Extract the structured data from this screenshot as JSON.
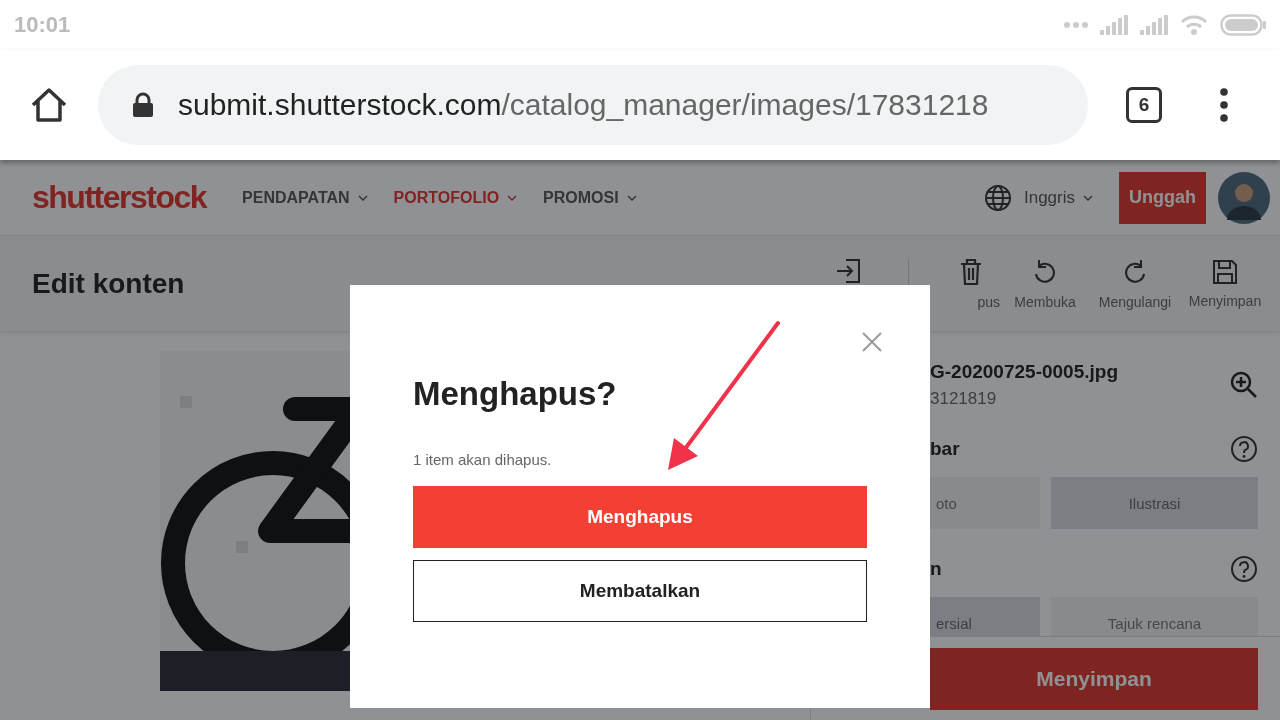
{
  "status_bar": {
    "time": "10:01"
  },
  "browser": {
    "url_host": "submit.shutterstock.com",
    "url_path": "/catalog_manager/images/17831218",
    "tab_count": "6"
  },
  "header": {
    "logo": "shutterstock",
    "nav": [
      {
        "label": "PENDAPATAN",
        "selected": false
      },
      {
        "label": "PORTOFOLIO",
        "selected": true
      },
      {
        "label": "PROMOSI",
        "selected": false
      }
    ],
    "language": "Inggris",
    "upload": "Unggah"
  },
  "page": {
    "title": "Edit konten",
    "toolbar": [
      {
        "kind": "submit"
      },
      {
        "kind": "delete",
        "label": "pus"
      },
      {
        "kind": "undo",
        "label": "Membuka"
      },
      {
        "kind": "redo",
        "label": "Mengulangi"
      },
      {
        "kind": "save",
        "label": "Menyimpan"
      }
    ]
  },
  "panel": {
    "filename": "G-20200725-0005.jpg",
    "id": "3121819",
    "sections": [
      {
        "heading": "bar",
        "options": [
          {
            "label": "oto",
            "selected": false
          },
          {
            "label": "Ilustrasi",
            "selected": true
          }
        ]
      },
      {
        "heading": "n",
        "options": [
          {
            "label": "ersial",
            "selected": true
          },
          {
            "label": "Tajuk rencana",
            "selected": false
          }
        ]
      }
    ],
    "save": "Menyimpan"
  },
  "dialog": {
    "title": "Menghapus?",
    "message": "1 item akan dihapus.",
    "confirm": "Menghapus",
    "cancel": "Membatalkan"
  }
}
